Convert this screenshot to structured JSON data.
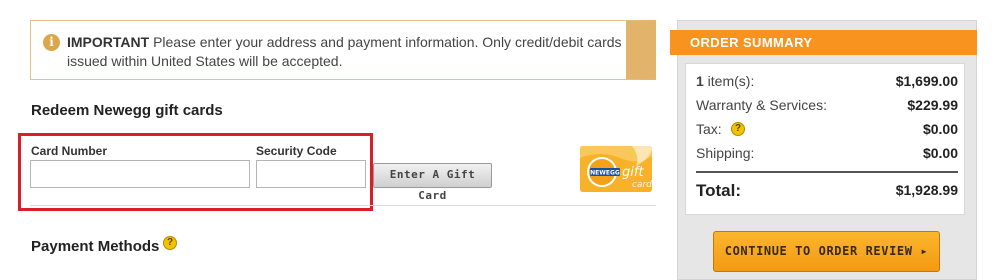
{
  "notice": {
    "icon": "info-icon",
    "strong": "IMPORTANT",
    "text": " Please enter your address and payment information. Only credit/debit cards issued within United States will be accepted."
  },
  "gift_cards": {
    "heading": "Redeem Newegg gift cards",
    "card_number_label": "Card Number",
    "card_number_value": "",
    "security_code_label": "Security Code",
    "security_code_value": "",
    "button_label": "Enter A Gift Card",
    "image_brand_text": "NEWEGG",
    "image_gift_text": "gift",
    "image_card_text": "card"
  },
  "payment": {
    "heading": "Payment Methods",
    "help_icon": "help-icon"
  },
  "summary": {
    "header": "ORDER SUMMARY",
    "items_count": "1",
    "items_label": " item(s):",
    "items_value": "$1,699.00",
    "warranty_label": "Warranty & Services:",
    "warranty_value": "$229.99",
    "tax_label": "Tax:",
    "tax_value": "$0.00",
    "shipping_label": "Shipping:",
    "shipping_value": "$0.00",
    "total_label": "Total:",
    "total_value": "$1,928.99",
    "continue_label": "CONTINUE TO ORDER REVIEW ▸"
  },
  "colors": {
    "accent_orange": "#f7931e",
    "highlight_red": "#d9202a",
    "notice_border": "#e2b36b"
  }
}
